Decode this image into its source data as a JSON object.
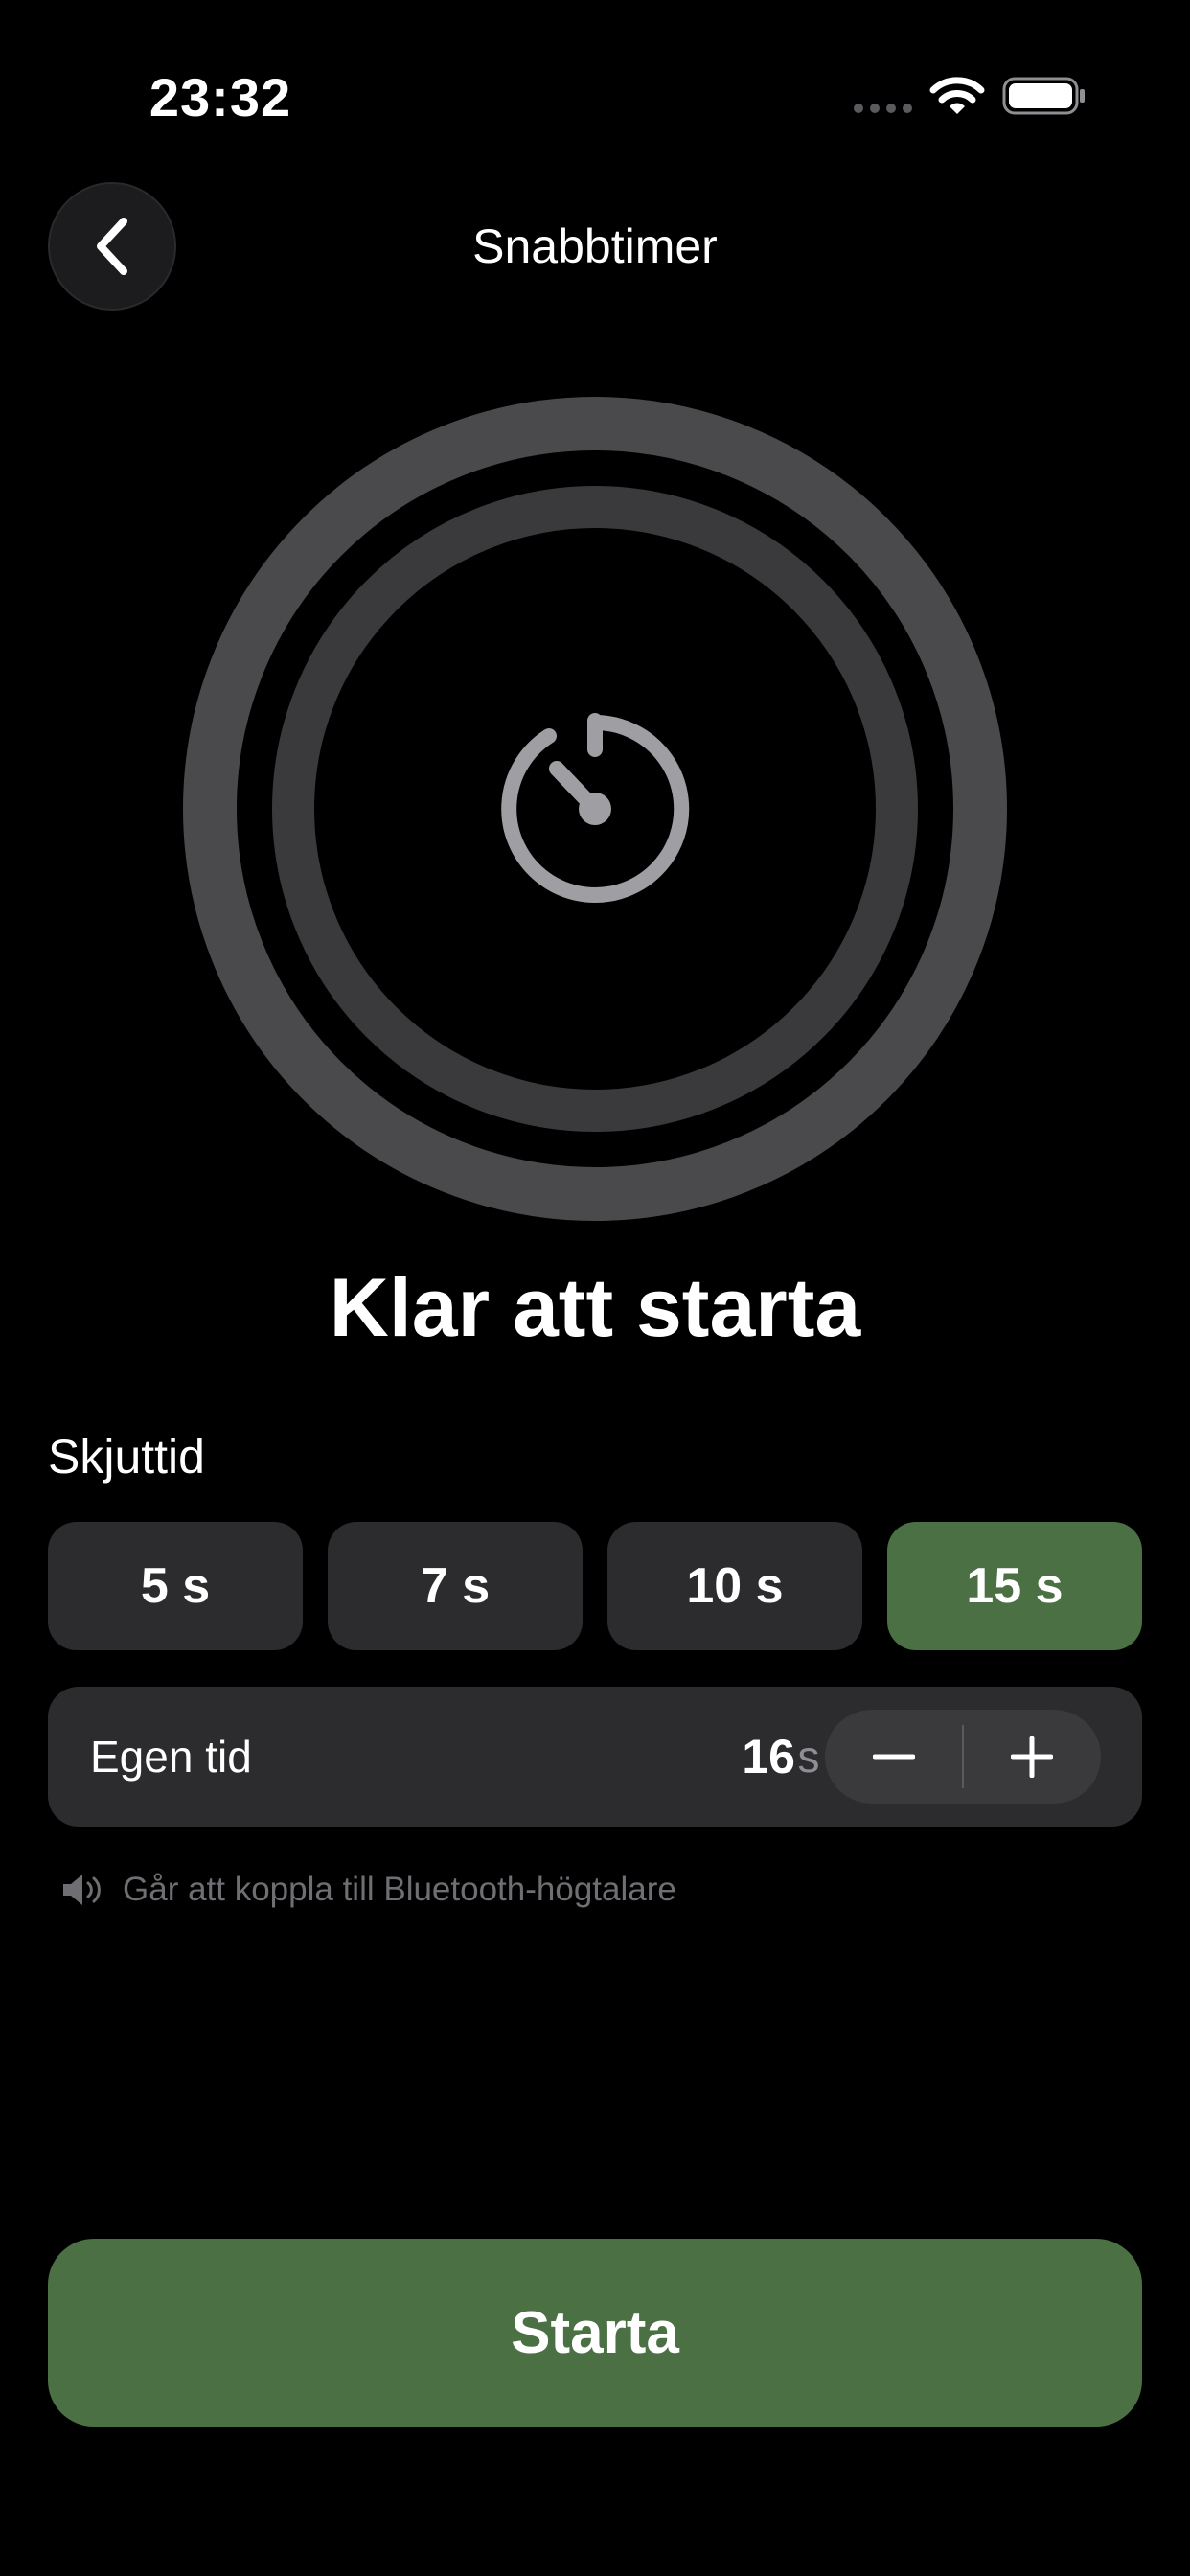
{
  "status_bar": {
    "time": "23:32",
    "icons": [
      "cellular-signal-icon",
      "wifi-icon",
      "battery-icon"
    ]
  },
  "nav": {
    "back_icon": "chevron-left-icon",
    "title": "Snabbtimer"
  },
  "timer": {
    "icon": "stopwatch-icon",
    "status": "Klar att starta"
  },
  "shot_time": {
    "label": "Skjuttid",
    "presets": [
      {
        "label": "5 s",
        "selected": false
      },
      {
        "label": "7 s",
        "selected": false
      },
      {
        "label": "10 s",
        "selected": false
      },
      {
        "label": "15 s",
        "selected": true
      }
    ]
  },
  "custom_time": {
    "label": "Egen tid",
    "value": "16",
    "unit": "s",
    "decrement_icon": "minus-icon",
    "increment_icon": "plus-icon"
  },
  "hint": {
    "icon": "speaker-icon",
    "text": "Går att koppla till Bluetooth-högtalare"
  },
  "start_button": {
    "label": "Starta"
  },
  "colors": {
    "background": "#000000",
    "accent_green": "#4a7043",
    "chip_bg": "#2c2c2e",
    "ring_outer": "#4a4a4c",
    "ring_inner": "#3a3a3c",
    "icon_gray": "#9e9ea3",
    "hint_gray": "#6e6e73"
  }
}
